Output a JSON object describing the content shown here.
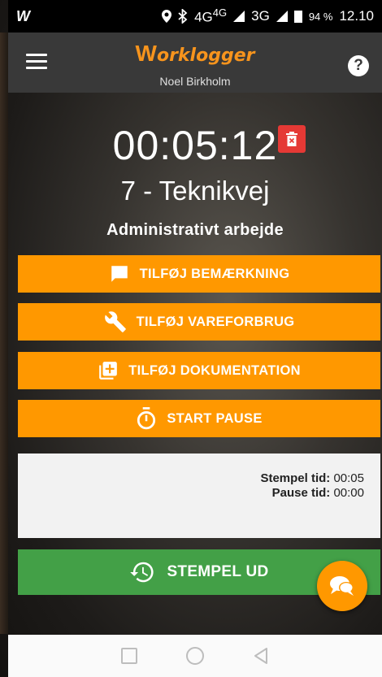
{
  "status_bar": {
    "app_icon": "W",
    "network": "4G",
    "network_sup": "4G",
    "network2": "3G",
    "battery": "94 %",
    "time": "12.10"
  },
  "header": {
    "logo_letter": "W",
    "logo_text": "orklogger",
    "user_name": "Noel Birkholm",
    "help_label": "?"
  },
  "timer": {
    "elapsed": "00:05:12"
  },
  "project": "7 - Teknikvej",
  "task": "Administrativt arbejde",
  "actions": {
    "add_note": "TILFØJ BEMÆRKNING",
    "add_material": "TILFØJ VAREFORBRUG",
    "add_documentation": "TILFØJ DOKUMENTATION",
    "start_pause": "START PAUSE"
  },
  "info": {
    "stamp_label": "Stempel tid:",
    "stamp_value": "00:05",
    "pause_label": "Pause tid:",
    "pause_value": "00:00"
  },
  "stamp_out": "STEMPEL UD",
  "colors": {
    "accent": "#ff9800",
    "stamp_out": "#43a047",
    "delete": "#e53935",
    "header": "#393939"
  },
  "icons": {
    "menu": "hamburger-icon",
    "help": "help-icon",
    "delete": "trash-icon",
    "note": "comment-icon",
    "material": "wrench-icon",
    "documentation": "add-library-icon",
    "pause": "stopwatch-icon",
    "stamp_out": "history-icon",
    "chat": "chat-icon"
  }
}
